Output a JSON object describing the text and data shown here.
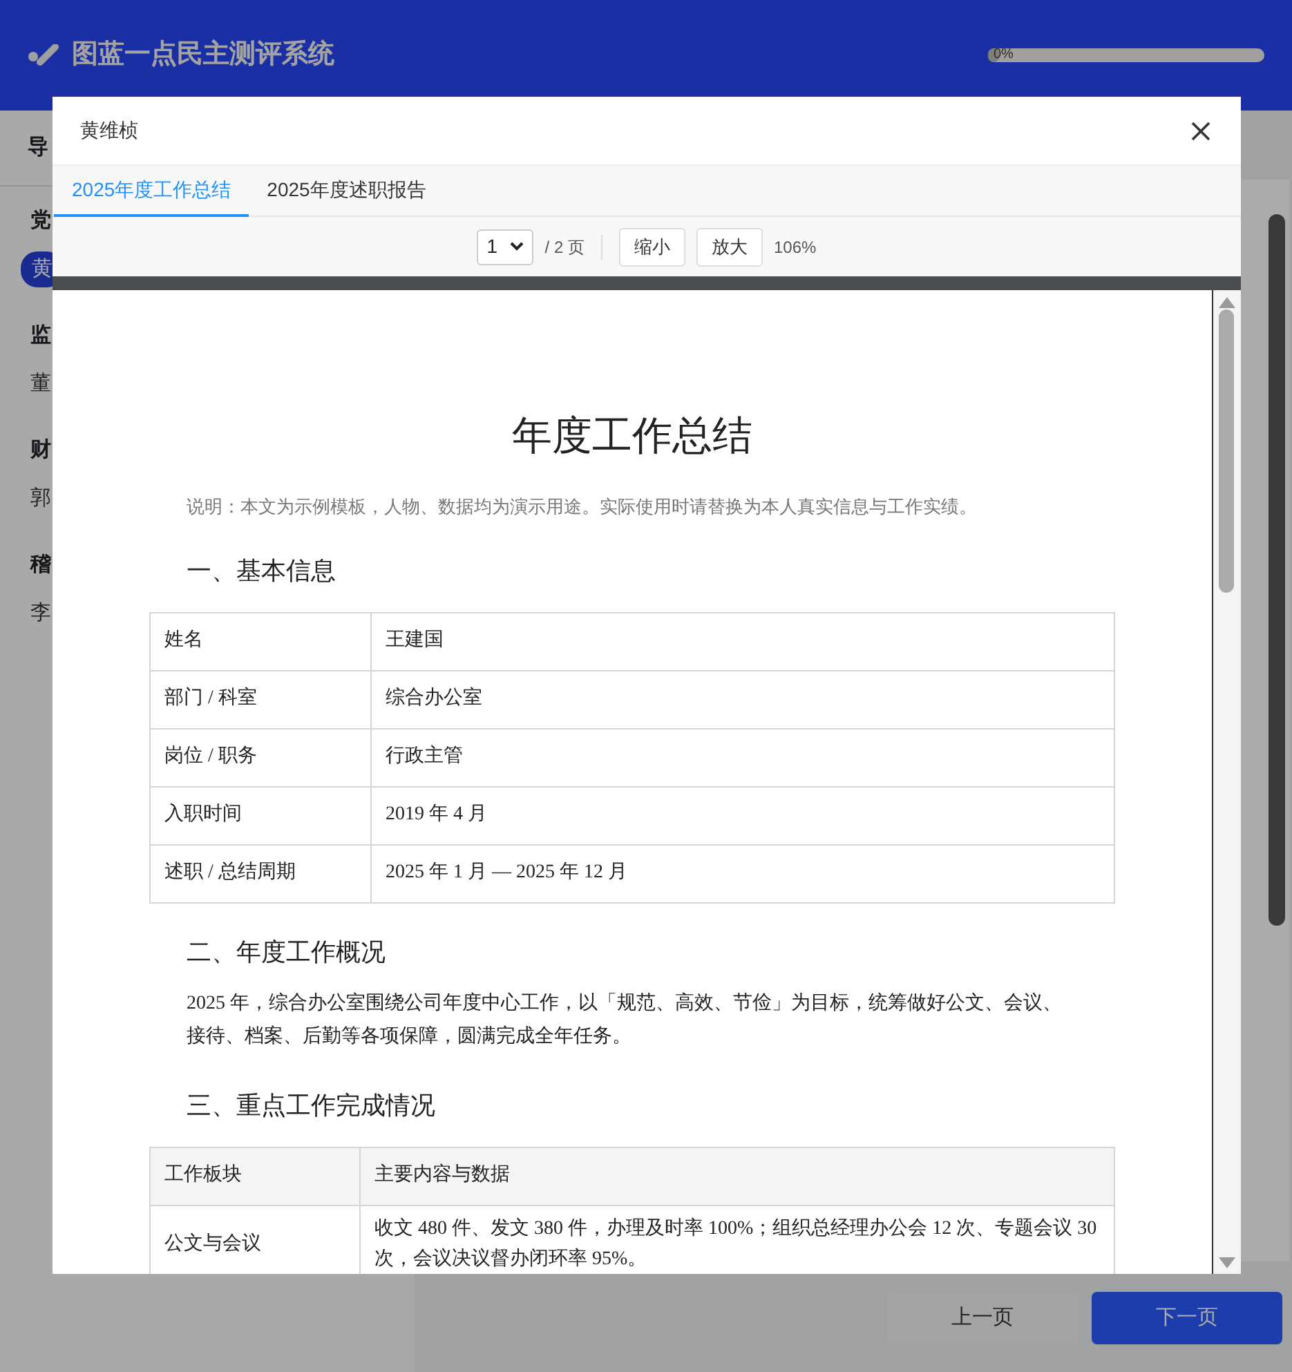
{
  "header": {
    "title": "图蓝一点民主测评系统",
    "progress": {
      "text": "0%",
      "level": 0
    }
  },
  "sidebar": {
    "heading": "导",
    "groups": [
      {
        "label": "党",
        "members": [
          {
            "name": "黄",
            "selected": true
          }
        ]
      },
      {
        "label": "监",
        "members": [
          {
            "name": "董",
            "selected": false
          }
        ]
      },
      {
        "label": "财",
        "members": [
          {
            "name": "郭",
            "selected": false
          }
        ]
      },
      {
        "label": "稽",
        "members": [
          {
            "name": "李",
            "selected": false
          }
        ]
      }
    ]
  },
  "modal": {
    "title": "黄维桢",
    "tabs": [
      {
        "label": "2025年度工作总结",
        "selected": true
      },
      {
        "label": "2025年度述职报告",
        "selected": false
      }
    ],
    "toolbar": {
      "page_select": "1",
      "page_total": "/ 2 页",
      "buttons": [
        "缩小",
        "放大"
      ],
      "zoom": "106%"
    },
    "document": {
      "title": "年度工作总结",
      "note": "说明：本文为示例模板，人物、数据均为演示用途。实际使用时请替换为本人真实信息与工作实绩。",
      "blocks": [
        {
          "kind": "heading",
          "text": "一、基本信息"
        },
        {
          "kind": "table",
          "rows": [
            [
              "姓名",
              "王建国"
            ],
            [
              "部门 / 科室",
              "综合办公室"
            ],
            [
              "岗位 / 职务",
              "行政主管"
            ],
            [
              "入职时间",
              "2019 年 4 月"
            ],
            [
              "述职 / 总结周期",
              "2025 年 1 月 — 2025 年 12 月"
            ]
          ]
        },
        {
          "kind": "heading",
          "text": "二、年度工作概况"
        },
        {
          "kind": "paragraph",
          "text": "2025 年，综合办公室围绕公司年度中心工作，以「规范、高效、节俭」为目标，统筹做好公文、会议、接待、档案、后勤等各项保障，圆满完成全年任务。"
        },
        {
          "kind": "heading",
          "text": "三、重点工作完成情况"
        },
        {
          "kind": "table",
          "columns": [
            "工作板块",
            "主要内容与数据"
          ],
          "rows": [
            [
              "公文与会议",
              "收文 480 件、发文 380 件，办理及时率 100%；组织总经理办公会 12 次、专题会议 30 次，会议决议督办闭环率 95%。"
            ]
          ]
        }
      ]
    }
  },
  "footer_buttons": [
    {
      "label": "上一页",
      "kind": "secondary"
    },
    {
      "label": "下一页",
      "kind": "primary"
    }
  ]
}
